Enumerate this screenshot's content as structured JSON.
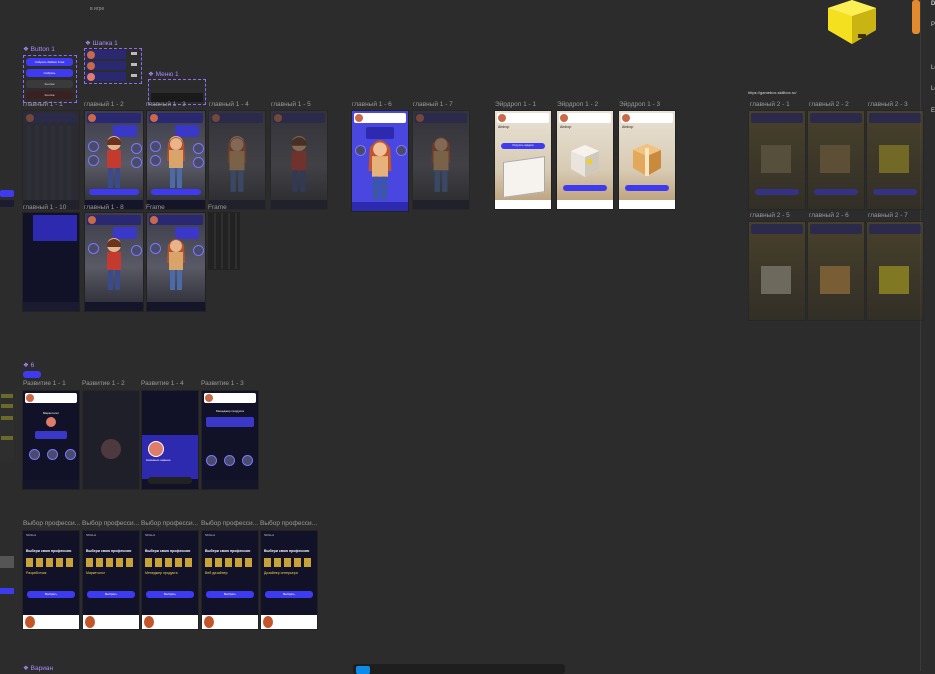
{
  "canvas": {
    "top_label": "в игре"
  },
  "components": {
    "button": {
      "label": "Button 1",
      "btn1": "Собрать бабкин 6 ккк",
      "btn2": "Собрать",
      "btn3": "Кнопка",
      "btn4": "Кнопка"
    },
    "header": {
      "label": "Шапка 1"
    },
    "menu": {
      "label": "Меню 1"
    },
    "six": {
      "label": "6"
    },
    "variants": {
      "label": "Вариан"
    }
  },
  "frames_row1": [
    "главный 1 - 1",
    "главный 1 - 2",
    "главный 1 - 3",
    "главный 1 - 4",
    "главный 1 - 5",
    "главный 1 - 6",
    "главный 1 - 7"
  ],
  "airdrop": [
    "Эйрдроп 1 - 1",
    "Эйрдроп 1 - 2",
    "Эйрдроп 1 - 3"
  ],
  "frames_row2": [
    "главный 1 - 10",
    "главный 1 - 8",
    "Frame",
    "Frame"
  ],
  "right_group": {
    "url": "https://gamebox.skillbox.ru/",
    "labels": [
      "главный 2 - 1",
      "главный 2 - 2",
      "главный 2 - 3",
      "главный 2 - 5",
      "главный 2 - 6",
      "главный 2 - 7"
    ]
  },
  "development": [
    "Развитие 1 - 1",
    "Развитие 1 - 2",
    "Развитие 1 - 4",
    "Развитие 1 - 3"
  ],
  "profession_frames": [
    "Выбор професси...",
    "Выбор професси...",
    "Выбор професси...",
    "Выбор професси...",
    "Выбор професси..."
  ],
  "profession_content": {
    "heading": "Выбери свою профессию",
    "titles": [
      "Разработчик",
      "Маркетолог",
      "Менеджер продукта",
      "Веб дизайнер",
      "Дизайнер интерьера"
    ],
    "cta": "Выбрать",
    "top": "SKILLA"
  },
  "airdrop_content": {
    "title": "Airdrop",
    "cta": "Получить подарок"
  },
  "development_content": {
    "title": "Маркетолог",
    "sub": "Менеджер продукта",
    "name": "Название навыка"
  },
  "right_panel": {
    "items": [
      "De",
      "Pa",
      "Lo",
      "Lo",
      "Ex"
    ]
  },
  "colors": {
    "canvas": "#2c2c2c",
    "accent": "#3d3af0",
    "purple": "#4a46e0",
    "yellow": "#f4e01e"
  }
}
